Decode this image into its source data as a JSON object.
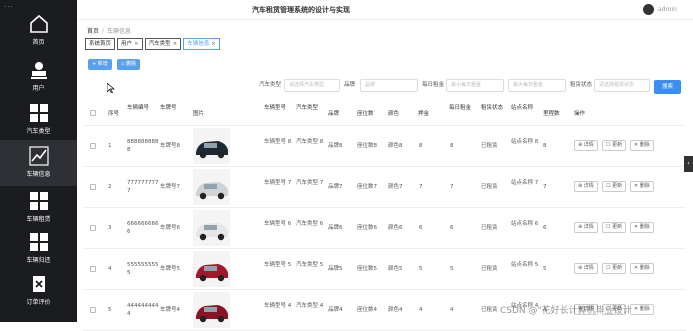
{
  "sidebar": {
    "items": [
      {
        "label": "首页",
        "icon": "home-icon"
      },
      {
        "label": "用户",
        "icon": "user-icon"
      },
      {
        "label": "汽车类型",
        "icon": "grid-icon"
      },
      {
        "label": "车辆信息",
        "icon": "chart-icon"
      },
      {
        "label": "车辆租赁",
        "icon": "grid-icon"
      },
      {
        "label": "车辆归还",
        "icon": "grid-icon"
      },
      {
        "label": "订单评价",
        "icon": "x-doc-icon"
      }
    ]
  },
  "header": {
    "title": "汽车租赁管理系统的设计与实现",
    "user": "admin"
  },
  "breadcrumb": {
    "home": "首页",
    "current": "车辆信息"
  },
  "tabs": [
    "系统首页",
    "用户",
    "汽车类型",
    "车辆信息"
  ],
  "toolbar": {
    "add": "+ 新增",
    "delete": "删除"
  },
  "filters": [
    {
      "label": "汽车类型",
      "placeholder": "请选择汽车类型"
    },
    {
      "label": "品牌",
      "placeholder": "品牌"
    },
    {
      "label": "每日租金",
      "placeholder": "最小每日租金"
    },
    {
      "label": "",
      "placeholder": "最大每日租金"
    },
    {
      "label": "租赁状态",
      "placeholder": "请选择租赁状态"
    }
  ],
  "search_label": "搜索",
  "table": {
    "headers": [
      "序号",
      "车辆编号",
      "车牌号",
      "图片",
      "车辆型号",
      "汽车类型",
      "品牌",
      "座位数",
      "颜色",
      "押金",
      "每日租金",
      "租赁状态",
      "站点名称",
      "里程数",
      "操作"
    ],
    "rows": [
      {
        "idx": "1",
        "code": "888888888 8",
        "plate": "车牌号8",
        "model": "车辆型号 8",
        "type": "汽车类型 8",
        "brand": "品牌8",
        "seats": "座位数8",
        "color": "颜色8",
        "deposit": "8",
        "rent": "8",
        "status": "已租赁",
        "station": "站点名称 8",
        "mileage": "8",
        "car_color": "#1d2a33"
      },
      {
        "idx": "2",
        "code": "777777777 7",
        "plate": "车牌号7",
        "model": "车辆型号 7",
        "type": "汽车类型 7",
        "brand": "品牌7",
        "seats": "座位数7",
        "color": "颜色7",
        "deposit": "7",
        "rent": "7",
        "status": "已租赁",
        "station": "站点名称 7",
        "mileage": "7",
        "car_color": "#d0d3d6"
      },
      {
        "idx": "3",
        "code": "666666666 6",
        "plate": "车牌号6",
        "model": "车辆型号 6",
        "type": "汽车类型 6",
        "brand": "品牌6",
        "seats": "座位数6",
        "color": "颜色6",
        "deposit": "6",
        "rent": "6",
        "status": "已租赁",
        "station": "站点名称 6",
        "mileage": "6",
        "car_color": "#e4e6e8"
      },
      {
        "idx": "4",
        "code": "555555555 5",
        "plate": "车牌号5",
        "model": "车辆型号 5",
        "type": "汽车类型 5",
        "brand": "品牌5",
        "seats": "座位数5",
        "color": "颜色5",
        "deposit": "5",
        "rent": "5",
        "status": "已租赁",
        "station": "站点名称 5",
        "mileage": "5",
        "car_color": "#a3182a"
      },
      {
        "idx": "5",
        "code": "444444444 4",
        "plate": "车牌号4",
        "model": "车辆型号 4",
        "type": "汽车类型 4",
        "brand": "品牌4",
        "seats": "座位数4",
        "color": "颜色4",
        "deposit": "4",
        "rent": "4",
        "status": "已租赁",
        "station": "站点名称 4",
        "mileage": "4",
        "car_color": "#8a1424"
      }
    ],
    "actions": {
      "detail": "详情",
      "edit": "更新",
      "delete": "删除"
    }
  },
  "watermark": "CSDN @\"花好长计算机毕业设计"
}
